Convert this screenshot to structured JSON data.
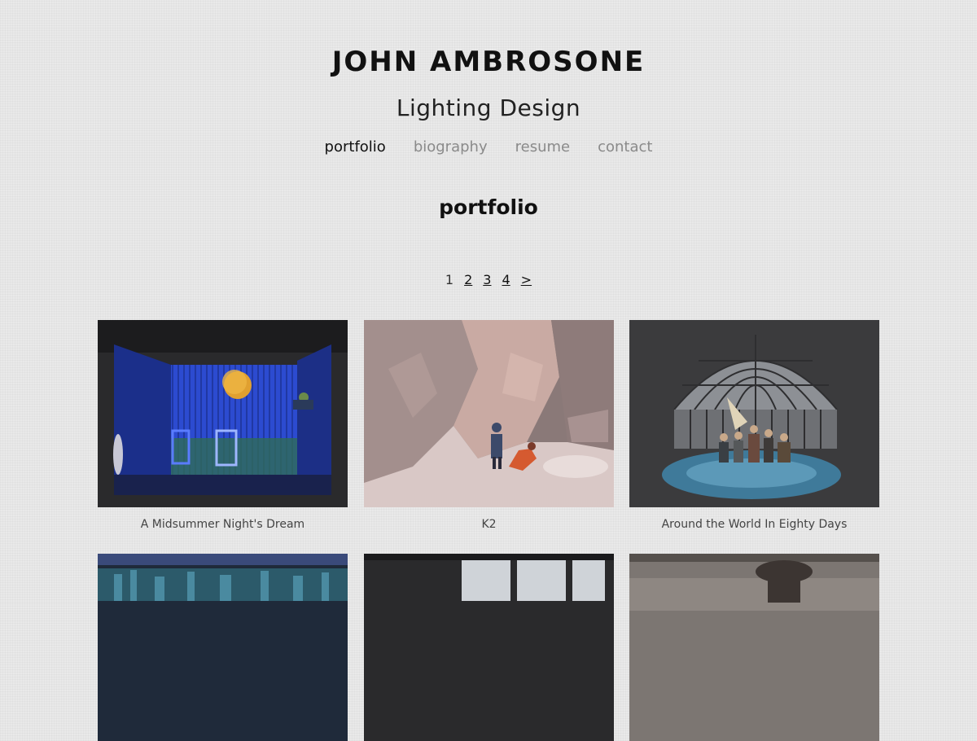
{
  "header": {
    "title": "JOHN AMBROSONE",
    "subtitle": "Lighting Design"
  },
  "nav": {
    "items": [
      {
        "label": "portfolio",
        "active": true
      },
      {
        "label": "biography",
        "active": false
      },
      {
        "label": "resume",
        "active": false
      },
      {
        "label": "contact",
        "active": false
      }
    ]
  },
  "main": {
    "heading": "portfolio",
    "pagination": {
      "current": "1",
      "pages": [
        "2",
        "3",
        "4"
      ],
      "next": ">"
    },
    "projects": [
      {
        "title": "A Midsummer Night's Dream",
        "image": "midsummer-stage-photo"
      },
      {
        "title": "K2",
        "image": "k2-stage-photo"
      },
      {
        "title": "Around the World In Eighty Days",
        "image": "around-the-world-stage-photo"
      },
      {
        "title": "",
        "image": "city-skyline-stage-photo"
      },
      {
        "title": "",
        "image": "window-stage-photo"
      },
      {
        "title": "",
        "image": "silhouette-stage-photo"
      }
    ]
  },
  "colors": {
    "background": "#e9e9e9",
    "text": "#111111",
    "nav_inactive": "#8a8a8a"
  }
}
